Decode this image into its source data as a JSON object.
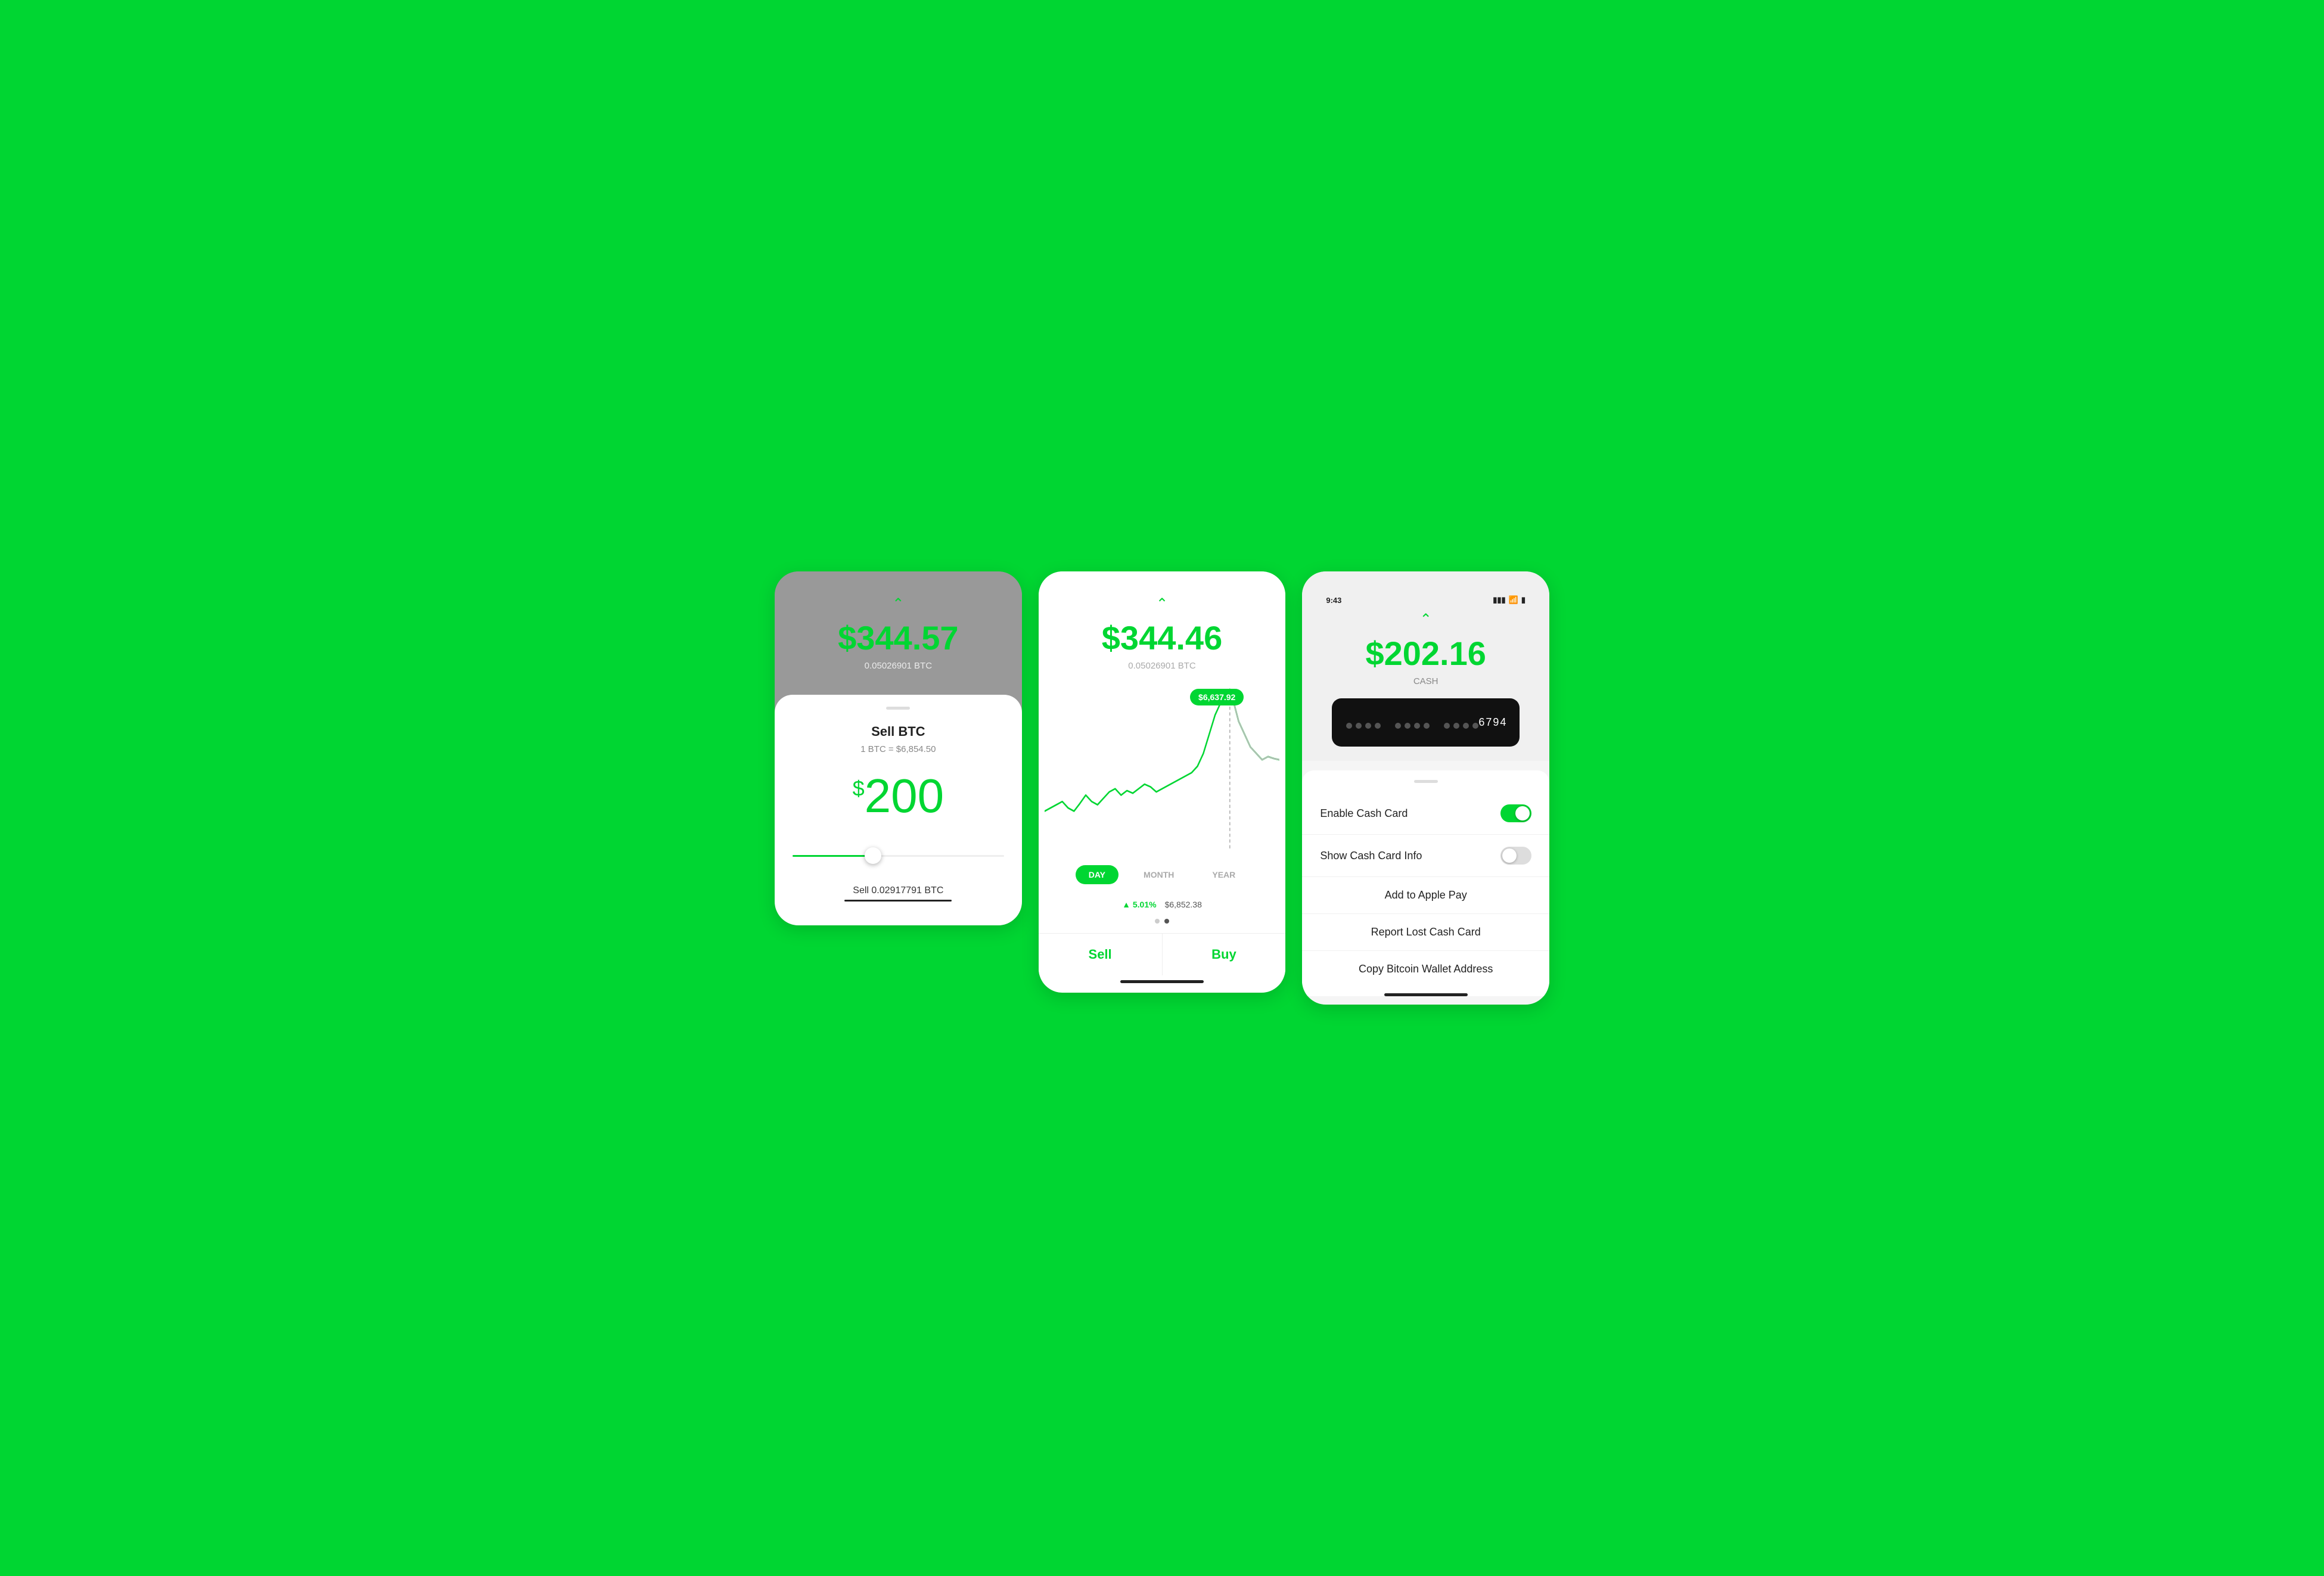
{
  "screen1": {
    "chevron": "^",
    "balance": "$344.57",
    "btc_amount": "0.05026901 BTC",
    "handle": "",
    "title": "Sell BTC",
    "rate": "1 BTC = $6,854.50",
    "sell_amount_symbol": "$",
    "sell_amount": "200",
    "sell_label": "Sell 0.02917791 BTC"
  },
  "screen2": {
    "chevron": "^",
    "balance": "$344.46",
    "btc_amount": "0.05026901 BTC",
    "tooltip": "$6,637.92",
    "time_buttons": [
      {
        "label": "DAY",
        "active": true
      },
      {
        "label": "MONTH",
        "active": false
      },
      {
        "label": "YEAR",
        "active": false
      }
    ],
    "change_pct": "▲ 5.01%",
    "change_price": "$6,852.38",
    "sell_btn": "Sell",
    "buy_btn": "Buy"
  },
  "screen3": {
    "status_time": "9:43",
    "chevron": "^",
    "balance": "$202.16",
    "cash_label": "CASH",
    "card_last4": "6794",
    "options": [
      {
        "label": "Enable Cash Card",
        "type": "toggle",
        "state": "on"
      },
      {
        "label": "Show Cash Card Info",
        "type": "toggle",
        "state": "off"
      },
      {
        "label": "Add to Apple Pay",
        "type": "action"
      },
      {
        "label": "Report Lost Cash Card",
        "type": "action"
      },
      {
        "label": "Copy Bitcoin Wallet Address",
        "type": "action"
      }
    ]
  }
}
